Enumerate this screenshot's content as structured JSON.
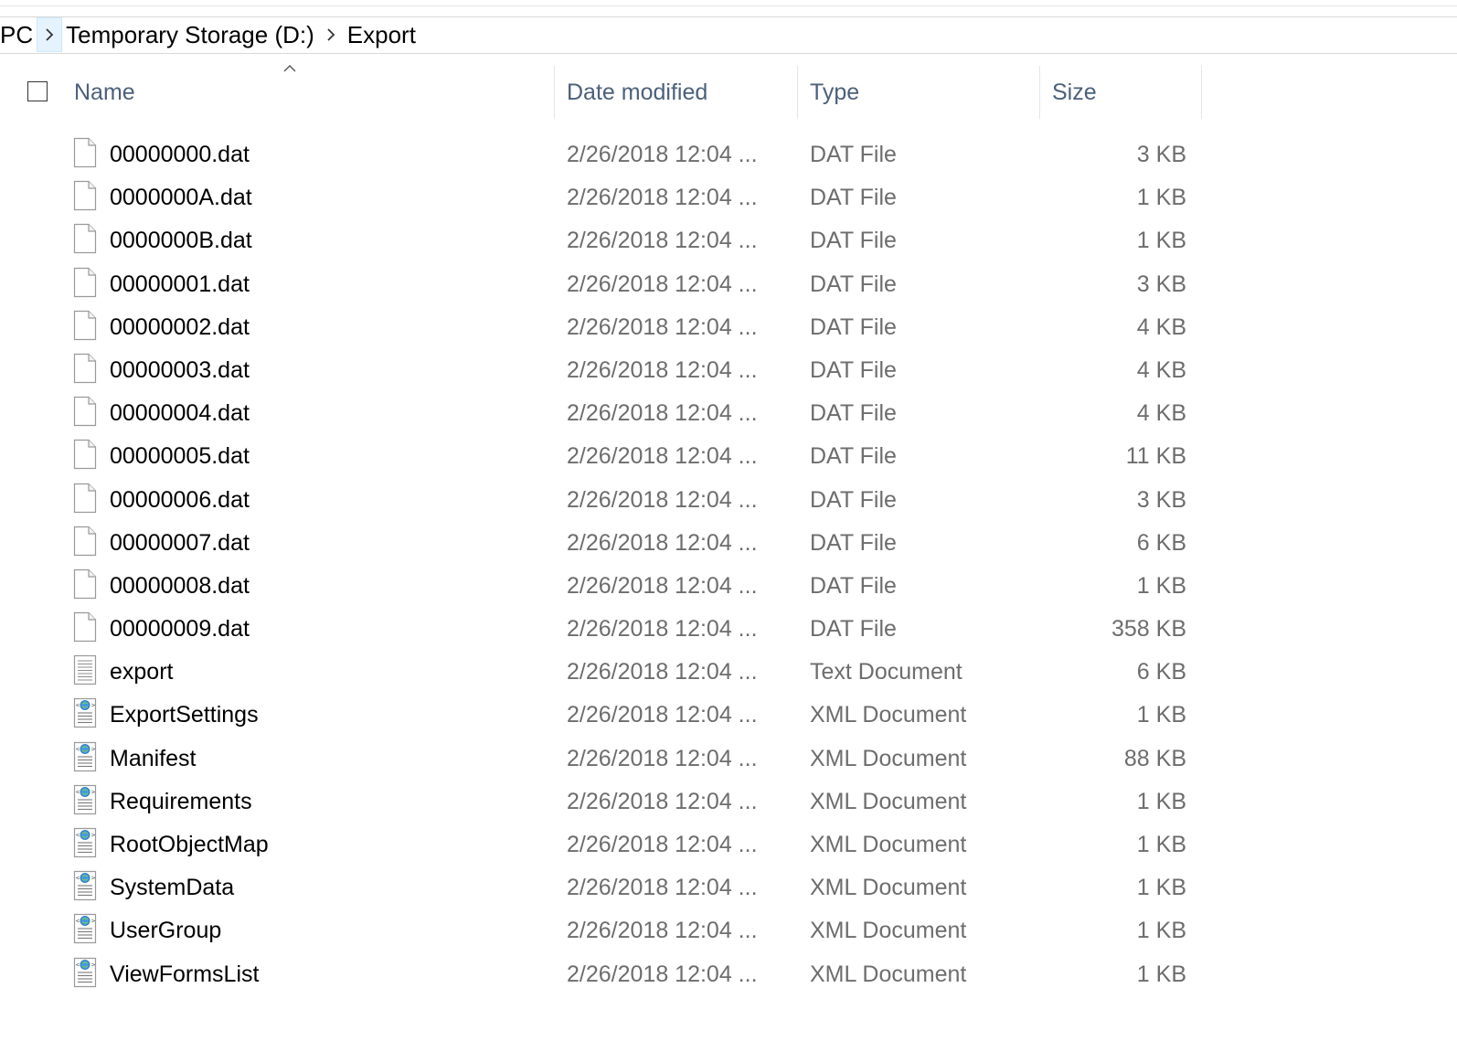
{
  "breadcrumb": {
    "items": [
      "PC",
      "Temporary Storage (D:)",
      "Export"
    ]
  },
  "columns": {
    "name": "Name",
    "date": "Date modified",
    "type": "Type",
    "size": "Size"
  },
  "icons": {
    "dat": "blank-file-icon",
    "txt": "text-document-icon",
    "xml": "xml-document-icon"
  },
  "files": [
    {
      "name": "00000000.dat",
      "date": "2/26/2018 12:04 ...",
      "type": "DAT File",
      "size": "3 KB",
      "icon": "dat"
    },
    {
      "name": "0000000A.dat",
      "date": "2/26/2018 12:04 ...",
      "type": "DAT File",
      "size": "1 KB",
      "icon": "dat"
    },
    {
      "name": "0000000B.dat",
      "date": "2/26/2018 12:04 ...",
      "type": "DAT File",
      "size": "1 KB",
      "icon": "dat"
    },
    {
      "name": "00000001.dat",
      "date": "2/26/2018 12:04 ...",
      "type": "DAT File",
      "size": "3 KB",
      "icon": "dat"
    },
    {
      "name": "00000002.dat",
      "date": "2/26/2018 12:04 ...",
      "type": "DAT File",
      "size": "4 KB",
      "icon": "dat"
    },
    {
      "name": "00000003.dat",
      "date": "2/26/2018 12:04 ...",
      "type": "DAT File",
      "size": "4 KB",
      "icon": "dat"
    },
    {
      "name": "00000004.dat",
      "date": "2/26/2018 12:04 ...",
      "type": "DAT File",
      "size": "4 KB",
      "icon": "dat"
    },
    {
      "name": "00000005.dat",
      "date": "2/26/2018 12:04 ...",
      "type": "DAT File",
      "size": "11 KB",
      "icon": "dat"
    },
    {
      "name": "00000006.dat",
      "date": "2/26/2018 12:04 ...",
      "type": "DAT File",
      "size": "3 KB",
      "icon": "dat"
    },
    {
      "name": "00000007.dat",
      "date": "2/26/2018 12:04 ...",
      "type": "DAT File",
      "size": "6 KB",
      "icon": "dat"
    },
    {
      "name": "00000008.dat",
      "date": "2/26/2018 12:04 ...",
      "type": "DAT File",
      "size": "1 KB",
      "icon": "dat"
    },
    {
      "name": "00000009.dat",
      "date": "2/26/2018 12:04 ...",
      "type": "DAT File",
      "size": "358 KB",
      "icon": "dat"
    },
    {
      "name": "export",
      "date": "2/26/2018 12:04 ...",
      "type": "Text Document",
      "size": "6 KB",
      "icon": "txt"
    },
    {
      "name": "ExportSettings",
      "date": "2/26/2018 12:04 ...",
      "type": "XML Document",
      "size": "1 KB",
      "icon": "xml"
    },
    {
      "name": "Manifest",
      "date": "2/26/2018 12:04 ...",
      "type": "XML Document",
      "size": "88 KB",
      "icon": "xml"
    },
    {
      "name": "Requirements",
      "date": "2/26/2018 12:04 ...",
      "type": "XML Document",
      "size": "1 KB",
      "icon": "xml"
    },
    {
      "name": "RootObjectMap",
      "date": "2/26/2018 12:04 ...",
      "type": "XML Document",
      "size": "1 KB",
      "icon": "xml"
    },
    {
      "name": "SystemData",
      "date": "2/26/2018 12:04 ...",
      "type": "XML Document",
      "size": "1 KB",
      "icon": "xml"
    },
    {
      "name": "UserGroup",
      "date": "2/26/2018 12:04 ...",
      "type": "XML Document",
      "size": "1 KB",
      "icon": "xml"
    },
    {
      "name": "ViewFormsList",
      "date": "2/26/2018 12:04 ...",
      "type": "XML Document",
      "size": "1 KB",
      "icon": "xml"
    }
  ]
}
